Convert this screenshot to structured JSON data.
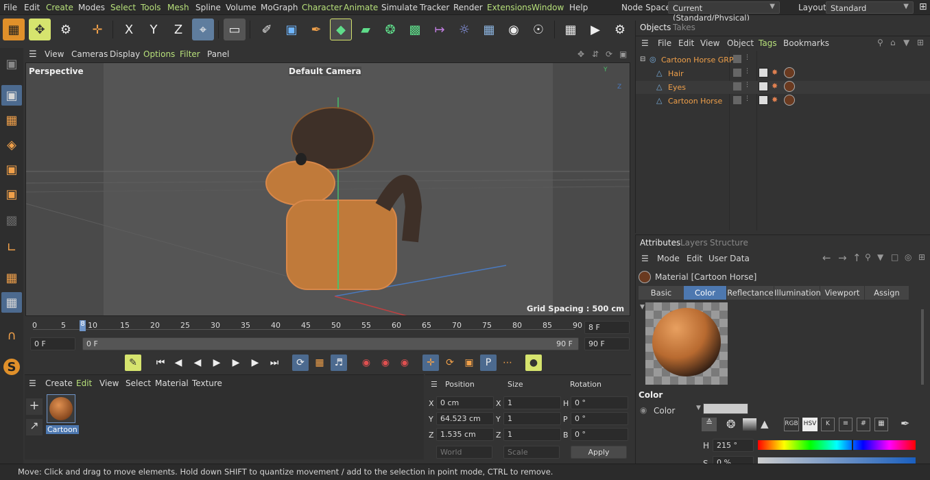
{
  "menubar": {
    "items": [
      "File",
      "Edit",
      "Create",
      "Modes",
      "Select",
      "Tools",
      "Mesh",
      "Spline",
      "Volume",
      "MoGraph",
      "Character",
      "Animate",
      "Simulate",
      "Tracker",
      "Render",
      "Extensions",
      "Window",
      "Help"
    ],
    "node_space_label": "Node Space:",
    "node_space_value": "Current (Standard/Physical)",
    "layout_label": "Layout:",
    "layout_value": "Standard"
  },
  "viewport": {
    "menu": [
      "View",
      "Cameras",
      "Display",
      "Options",
      "Filter",
      "Panel"
    ],
    "view_name": "Perspective",
    "camera_name": "Default Camera",
    "grid_spacing": "Grid Spacing : 500 cm"
  },
  "timeline": {
    "ticks": [
      "0",
      "5",
      "10",
      "15",
      "20",
      "25",
      "30",
      "35",
      "40",
      "45",
      "50",
      "55",
      "60",
      "65",
      "70",
      "75",
      "80",
      "85",
      "90"
    ],
    "current_frame_marker": "8",
    "end_frame_field": "8 F",
    "start_field": "0 F",
    "range_start": "0 F",
    "range_end": "90 F",
    "max_field": "90 F"
  },
  "material_manager": {
    "menu": [
      "Create",
      "Edit",
      "View",
      "Select",
      "Material",
      "Texture"
    ],
    "material_name": "Cartoon"
  },
  "coordinates": {
    "headers": {
      "position": "Position",
      "size": "Size",
      "rotation": "Rotation"
    },
    "rows": [
      {
        "axis": "X",
        "pos": "0 cm",
        "size_axis": "X",
        "size": "1",
        "rot_axis": "H",
        "rot": "0 °"
      },
      {
        "axis": "Y",
        "pos": "64.523 cm",
        "size_axis": "Y",
        "size": "1",
        "rot_axis": "P",
        "rot": "0 °"
      },
      {
        "axis": "Z",
        "pos": "1.535 cm",
        "size_axis": "Z",
        "size": "1",
        "rot_axis": "B",
        "rot": "0 °"
      }
    ],
    "world_label": "World",
    "scale_label": "Scale",
    "apply_label": "Apply"
  },
  "objects": {
    "tabs": [
      "Objects",
      "Takes"
    ],
    "menu": [
      "File",
      "Edit",
      "View",
      "Object",
      "Tags",
      "Bookmarks"
    ],
    "items": [
      {
        "name": "Cartoon Horse GRP",
        "level": 0
      },
      {
        "name": "Hair",
        "level": 1
      },
      {
        "name": "Eyes",
        "level": 1
      },
      {
        "name": "Cartoon Horse",
        "level": 1
      }
    ]
  },
  "attributes": {
    "tabs": [
      "Attributes",
      "Layers",
      "Structure"
    ],
    "menu": [
      "Mode",
      "Edit",
      "User Data"
    ],
    "title": "Material [Cartoon Horse]",
    "buttons": [
      "Basic",
      "Color",
      "Reflectance",
      "Illumination",
      "Viewport",
      "Assign"
    ],
    "active_button": "Color",
    "section_title": "Color",
    "color_label": "Color",
    "h_label": "H",
    "h_value": "215 °",
    "s_label": "S",
    "s_value": "0 %",
    "mode_buttons": [
      "RGB",
      "HSV",
      "K",
      "#"
    ]
  },
  "status": {
    "text": "Move: Click and drag to move elements. Hold down SHIFT to quantize movement / add to the selection in point mode, CTRL to remove."
  },
  "colors": {
    "accent_green": "#b7e07a",
    "accent_orange": "#f0a04a",
    "active_blue": "#4d78b0"
  }
}
